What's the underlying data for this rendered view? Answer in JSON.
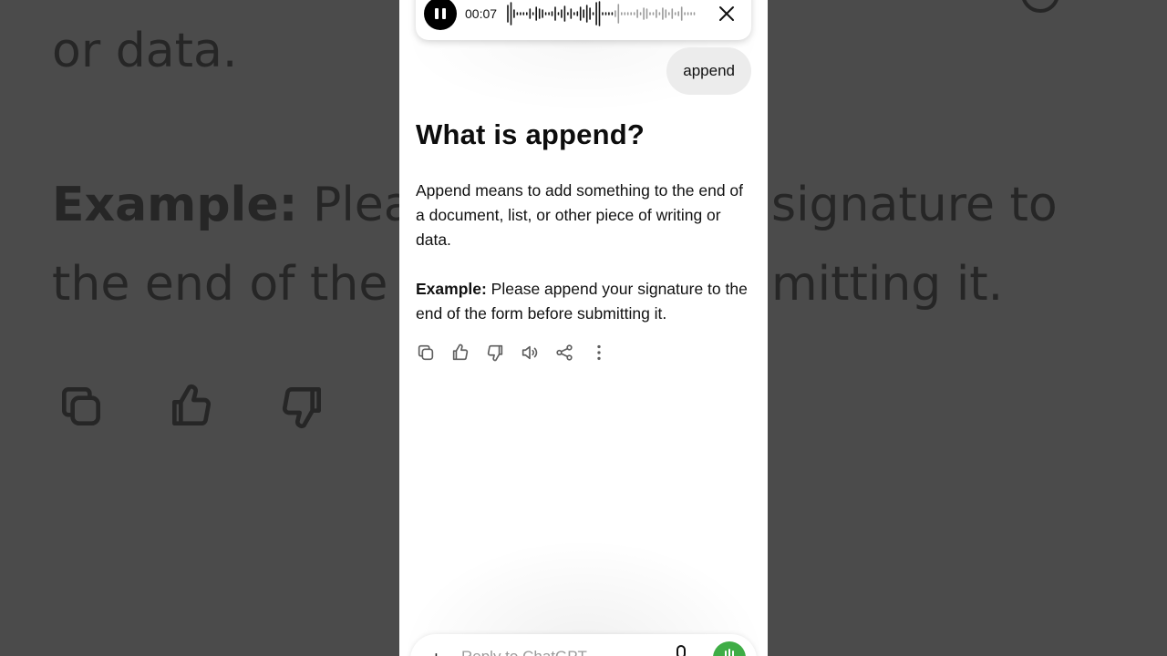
{
  "voice_mode": {
    "timer": "00:07"
  },
  "conversation": {
    "user_message": "append",
    "answer_heading": "What is append?",
    "answer_paragraph": "Append means to add something to the end of a document, list, or other piece of writing or data.",
    "example_label": "Example:",
    "example_text": " Please append your signature to the end of the form before submitting it.",
    "actions": [
      "copy-icon",
      "thumbs-up-icon",
      "thumbs-down-icon",
      "read-aloud-icon",
      "share-icon",
      "more-icon"
    ]
  },
  "composer": {
    "placeholder": "Reply to ChatGPT"
  },
  "background": {
    "line_1": "or data.",
    "line_2_label": "Example:",
    "line_2_rest": " Pleas",
    "line_2_right": "signature to",
    "line_3_left": "the end of the f",
    "line_3_right": "mitting it."
  },
  "colors": {
    "backdrop": "#4b4b4b",
    "voice_button": "#3fad46",
    "user_bubble": "#ececec"
  }
}
